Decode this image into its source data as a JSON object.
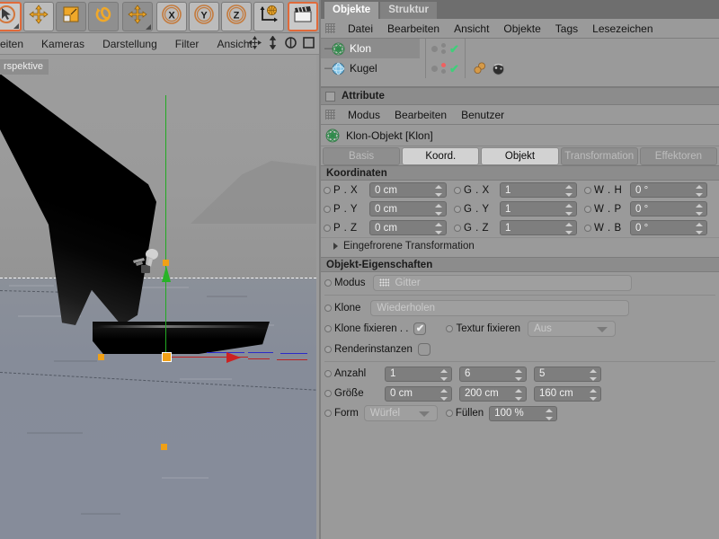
{
  "toolbar": {
    "buttons": [
      {
        "name": "selection-tool",
        "icon": "cursor-icon"
      },
      {
        "name": "move-tool",
        "icon": "move-arrows-icon"
      },
      {
        "name": "scale-tool",
        "icon": "scale-box-icon"
      },
      {
        "name": "rotate-tool",
        "icon": "rotate-circle-icon"
      },
      {
        "name": "move-tool-2",
        "icon": "move-arrows-icon"
      },
      {
        "name": "axis-x-lock",
        "icon": "x-axis-icon",
        "label": "X"
      },
      {
        "name": "axis-y-lock",
        "icon": "y-axis-icon",
        "label": "Y"
      },
      {
        "name": "axis-z-lock",
        "icon": "z-axis-icon",
        "label": "Z"
      },
      {
        "name": "world-coordinates",
        "icon": "globe-axis-icon"
      },
      {
        "name": "render-view",
        "icon": "clapperboard-icon"
      }
    ]
  },
  "viewport": {
    "menu_items": [
      "eiten",
      "Kameras",
      "Darstellung",
      "Filter",
      "Ansicht"
    ],
    "label": "rspektive",
    "icons": [
      "pan-icon",
      "dolly-icon",
      "rotate-icon",
      "maximize-icon"
    ]
  },
  "objects_panel": {
    "tabs": [
      {
        "label": "Objekte",
        "active": true
      },
      {
        "label": "Struktur",
        "active": false
      }
    ],
    "menu": [
      "Datei",
      "Bearbeiten",
      "Ansicht",
      "Objekte",
      "Tags",
      "Lesezeichen"
    ],
    "tree": [
      {
        "label": "Klon",
        "icon": "cloner-icon",
        "selected": true,
        "has_tags": false
      },
      {
        "label": "Kugel",
        "icon": "sphere-icon",
        "selected": false,
        "has_tags": true
      }
    ]
  },
  "attribute_panel": {
    "title": "Attribute",
    "menu": [
      "Modus",
      "Bearbeiten",
      "Benutzer"
    ],
    "object_name": "Klon-Objekt [Klon]",
    "object_icon": "cloner-icon",
    "tabs": [
      {
        "label": "Basis",
        "active": false
      },
      {
        "label": "Koord.",
        "active": true
      },
      {
        "label": "Objekt",
        "active": true
      },
      {
        "label": "Transformation",
        "active": false
      },
      {
        "label": "Effektoren",
        "active": false
      }
    ],
    "coordinates": {
      "header": "Koordinaten",
      "rows": [
        {
          "p_label": "P . X",
          "p_value": "0 cm",
          "g_label": "G . X",
          "g_value": "1",
          "w_label": "W . H",
          "w_value": "0 °"
        },
        {
          "p_label": "P . Y",
          "p_value": "0 cm",
          "g_label": "G . Y",
          "g_value": "1",
          "w_label": "W . P",
          "w_value": "0 °"
        },
        {
          "p_label": "P . Z",
          "p_value": "0 cm",
          "g_label": "G . Z",
          "g_value": "1",
          "w_label": "W . B",
          "w_value": "0 °"
        }
      ],
      "frozen_transform": "Eingefrorene Transformation"
    },
    "object_properties": {
      "header": "Objekt-Eigenschaften",
      "modus_label": "Modus",
      "modus_value": "Gitter",
      "klone_label": "Klone",
      "klone_value": "Wiederholen",
      "klone_fixieren_label": "Klone fixieren . .",
      "klone_fixieren_checked": true,
      "textur_fixieren_label": "Textur fixieren",
      "textur_fixieren_value": "Aus",
      "renderinstanzen_label": "Renderinstanzen",
      "renderinstanzen_checked": false,
      "anzahl_label": "Anzahl",
      "anzahl_values": [
        "1",
        "6",
        "5"
      ],
      "groesse_label": "Größe",
      "groesse_values": [
        "0 cm",
        "200 cm",
        "160 cm"
      ],
      "form_label": "Form",
      "form_value": "Würfel",
      "fuellen_label": "Füllen",
      "fuellen_value": "100 %"
    }
  },
  "colors": {
    "panel_bg": "#9a9a9a",
    "field_bg": "#7e7e7e",
    "accent_orange": "#f0a016",
    "axis_y_green": "#22aa22",
    "axis_x_red": "#c02020",
    "axis_z_blue": "#2a2ad0",
    "selection_orange": "#e06a3a",
    "check_green": "#3fcf7a"
  }
}
